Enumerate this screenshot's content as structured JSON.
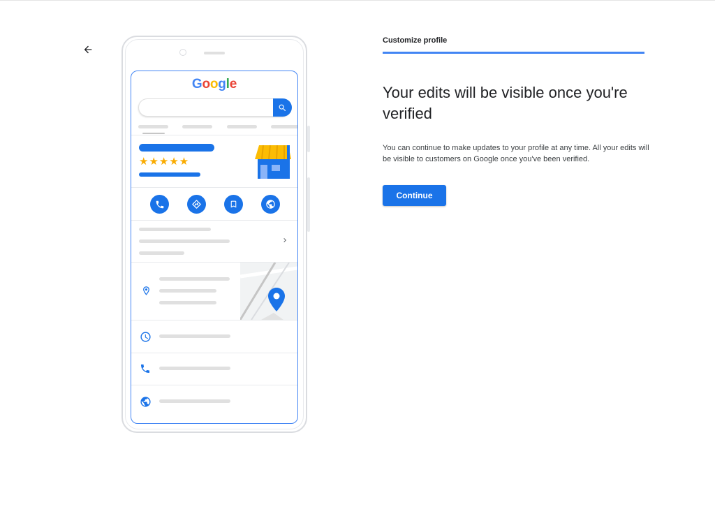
{
  "header": {
    "back_icon": "arrow-back-icon"
  },
  "illustration": {
    "logo_letters": [
      {
        "char": "G",
        "color": "#4285F4"
      },
      {
        "char": "o",
        "color": "#EA4335"
      },
      {
        "char": "o",
        "color": "#FBBC05"
      },
      {
        "char": "g",
        "color": "#4285F4"
      },
      {
        "char": "l",
        "color": "#34A853"
      },
      {
        "char": "e",
        "color": "#EA4335"
      }
    ],
    "stars": "★★★★★",
    "rating": 5,
    "action_icons": [
      "phone-icon",
      "directions-icon",
      "bookmark-icon",
      "website-icon"
    ],
    "detail_icons": [
      "chevron-right-icon",
      "location-pin-icon",
      "map-pin-icon",
      "clock-icon",
      "phone-icon",
      "globe-icon"
    ]
  },
  "step": {
    "title": "Customize profile"
  },
  "main": {
    "heading": "Your edits will be visible once you're verified",
    "body": "You can continue to make updates to your profile at any time. All your edits will be visible to customers on Google once you've been verified.",
    "continue_label": "Continue"
  },
  "colors": {
    "accent": "#1A73E8",
    "star": "#F9AB00",
    "awning": "#FBBC04"
  }
}
